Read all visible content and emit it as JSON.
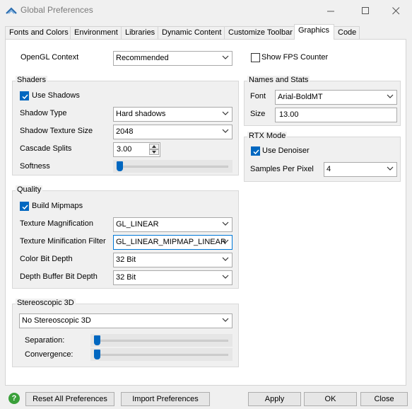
{
  "window": {
    "title": "Global Preferences",
    "minimize_icon": "minimize-icon",
    "maximize_icon": "maximize-icon",
    "close_icon": "close-icon"
  },
  "tabs": [
    "Fonts and Colors",
    "Environment",
    "Libraries",
    "Dynamic Content",
    "Customize Toolbar",
    "Graphics",
    "Code"
  ],
  "active_tab": "Graphics",
  "opengl": {
    "label": "OpenGL Context",
    "value": "Recommended"
  },
  "show_fps": {
    "label": "Show FPS Counter",
    "checked": false
  },
  "shaders": {
    "title": "Shaders",
    "use_shadows": {
      "label": "Use Shadows",
      "checked": true
    },
    "shadow_type": {
      "label": "Shadow Type",
      "value": "Hard shadows"
    },
    "shadow_texture_size": {
      "label": "Shadow Texture Size",
      "value": "2048"
    },
    "cascade_splits": {
      "label": "Cascade Splits",
      "value": "3.00"
    },
    "softness": {
      "label": "Softness",
      "level": 0.0
    }
  },
  "names_stats": {
    "title": "Names and Stats",
    "font": {
      "label": "Font",
      "value": "Arial-BoldMT"
    },
    "size": {
      "label": "Size",
      "value": "13.00"
    }
  },
  "rtx": {
    "title": "RTX Mode",
    "use_denoiser": {
      "label": "Use Denoiser",
      "checked": true
    },
    "samples": {
      "label": "Samples Per Pixel",
      "value": "4"
    }
  },
  "quality": {
    "title": "Quality",
    "build_mipmaps": {
      "label": "Build Mipmaps",
      "checked": true
    },
    "tex_mag": {
      "label": "Texture Magnification",
      "value": "GL_LINEAR"
    },
    "tex_min": {
      "label": "Texture Minification Filter",
      "value": "GL_LINEAR_MIPMAP_LINEAR"
    },
    "color_depth": {
      "label": "Color Bit Depth",
      "value": "32 Bit"
    },
    "depth_buffer": {
      "label": "Depth Buffer Bit Depth",
      "value": "32 Bit"
    }
  },
  "stereo": {
    "title": "Stereoscopic 3D",
    "mode": "No Stereoscopic 3D",
    "separation": {
      "label": "Separation:",
      "level": 0.0
    },
    "convergence": {
      "label": "Convergence:",
      "level": 0.0
    }
  },
  "footer": {
    "help_icon": "help-icon",
    "reset": "Reset All Preferences",
    "import": "Import Preferences",
    "apply": "Apply",
    "ok": "OK",
    "close": "Close"
  },
  "colors": {
    "accent": "#0067c0",
    "help_green": "#3aa03a"
  }
}
